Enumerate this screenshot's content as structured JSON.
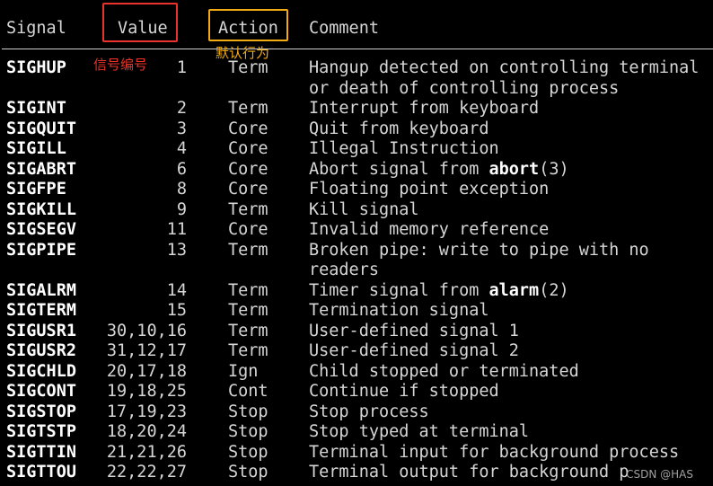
{
  "header": {
    "signal": "Signal",
    "value": "Value",
    "action": "Action",
    "comment": "Comment"
  },
  "annotations": {
    "value_note": "信号编号",
    "action_note": "默认行为",
    "value_box_color": "#e8322b",
    "action_box_color": "#f2ab12"
  },
  "rows": [
    {
      "signal": "SIGHUP",
      "value": "1",
      "action": "Term",
      "comment": [
        "Hangup detected on controlling terminal",
        "or death of controlling process"
      ]
    },
    {
      "signal": "SIGINT",
      "value": "2",
      "action": "Term",
      "comment": [
        "Interrupt from keyboard"
      ]
    },
    {
      "signal": "SIGQUIT",
      "value": "3",
      "action": "Core",
      "comment": [
        "Quit from keyboard"
      ]
    },
    {
      "signal": "SIGILL",
      "value": "4",
      "action": "Core",
      "comment": [
        "Illegal Instruction"
      ]
    },
    {
      "signal": "SIGABRT",
      "value": "6",
      "action": "Core",
      "comment_parts": {
        "pre": "Abort signal from ",
        "bold": "abort",
        "post": "(3)"
      }
    },
    {
      "signal": "SIGFPE",
      "value": "8",
      "action": "Core",
      "comment": [
        "Floating point exception"
      ]
    },
    {
      "signal": "SIGKILL",
      "value": "9",
      "action": "Term",
      "comment": [
        "Kill signal"
      ]
    },
    {
      "signal": "SIGSEGV",
      "value": "11",
      "action": "Core",
      "comment": [
        "Invalid memory reference"
      ]
    },
    {
      "signal": "SIGPIPE",
      "value": "13",
      "action": "Term",
      "comment": [
        "Broken pipe: write to pipe with no",
        "readers"
      ]
    },
    {
      "signal": "SIGALRM",
      "value": "14",
      "action": "Term",
      "comment_parts": {
        "pre": "Timer signal from ",
        "bold": "alarm",
        "post": "(2)"
      }
    },
    {
      "signal": "SIGTERM",
      "value": "15",
      "action": "Term",
      "comment": [
        "Termination signal"
      ]
    },
    {
      "signal": "SIGUSR1",
      "value": "30,10,16",
      "action": "Term",
      "comment": [
        "User-defined signal 1"
      ]
    },
    {
      "signal": "SIGUSR2",
      "value": "31,12,17",
      "action": "Term",
      "comment": [
        "User-defined signal 2"
      ]
    },
    {
      "signal": "SIGCHLD",
      "value": "20,17,18",
      "action": "Ign",
      "comment": [
        "Child stopped or terminated"
      ]
    },
    {
      "signal": "SIGCONT",
      "value": "19,18,25",
      "action": "Cont",
      "comment": [
        "Continue if stopped"
      ]
    },
    {
      "signal": "SIGSTOP",
      "value": "17,19,23",
      "action": "Stop",
      "comment": [
        "Stop process"
      ]
    },
    {
      "signal": "SIGTSTP",
      "value": "18,20,24",
      "action": "Stop",
      "comment": [
        "Stop typed at terminal"
      ]
    },
    {
      "signal": "SIGTTIN",
      "value": "21,21,26",
      "action": "Stop",
      "comment": [
        "Terminal input for background process"
      ]
    },
    {
      "signal": "SIGTTOU",
      "value": "22,22,27",
      "action": "Stop",
      "comment": [
        "Terminal output for background p"
      ]
    }
  ],
  "watermark": "CSDN @HAS"
}
